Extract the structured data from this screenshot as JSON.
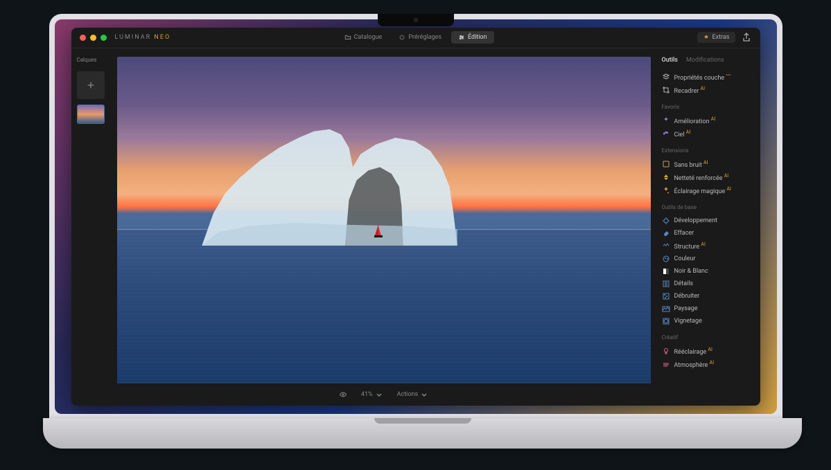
{
  "app": {
    "logo_main": "LUMINAR",
    "logo_suffix": "NEO"
  },
  "top_tabs": {
    "catalogue": "Catalogue",
    "presets": "Préréglages",
    "edition": "Édition"
  },
  "titlebar": {
    "extras": "Extras"
  },
  "left_panel": {
    "layers_label": "Calques"
  },
  "canvas_footer": {
    "zoom": "41%",
    "actions": "Actions"
  },
  "right_panel": {
    "tab_tools": "Outils",
    "tab_modifications": "Modifications",
    "layer_props": "Propriétés couche",
    "crop": "Recadrer",
    "section_favoris": "Favoris",
    "enhance": "Amélioration",
    "sky": "Ciel",
    "section_extensions": "Extensions",
    "noiseless": "Sans bruit",
    "supersharp": "Netteté renforcée",
    "magic_light": "Éclairage magique",
    "section_basics": "Outils de base",
    "develop": "Développement",
    "erase": "Effacer",
    "structure": "Structure",
    "color": "Couleur",
    "bw": "Noir & Blanc",
    "details": "Détails",
    "denoise": "Débruiter",
    "landscape": "Paysage",
    "vignette": "Vignetage",
    "section_creative": "Créatif",
    "relight": "Rééclairage",
    "atmosphere": "Atmosphère"
  }
}
